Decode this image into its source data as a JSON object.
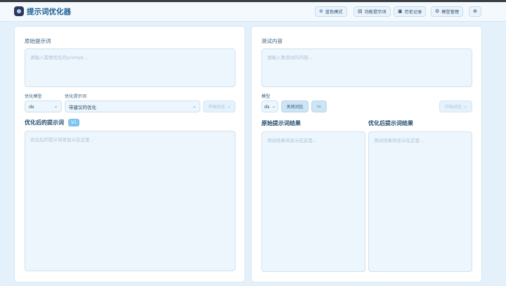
{
  "header": {
    "title": "提示词优化器",
    "buttons": [
      {
        "icon": "plus-circle-icon",
        "glyph": "⊕",
        "label": "蓝色模式"
      },
      {
        "icon": "document-icon",
        "glyph": "▤",
        "label": "功能提示词"
      },
      {
        "icon": "history-icon",
        "glyph": "▣",
        "label": "历史记录"
      },
      {
        "icon": "gear-icon",
        "glyph": "⚙",
        "label": "模型管理"
      }
    ],
    "globe_glyph": "⊕"
  },
  "left": {
    "original_label": "原始提示词",
    "original_placeholder": "请输入需要优化的prompt...",
    "model_label": "优化模型",
    "model_value": "ds",
    "prompt_label": "优化提示词",
    "prompt_value": "带建议的优化",
    "start_button": "开始优化 →",
    "optimized_title": "优化后的提示词",
    "version_badge": "V1",
    "optimized_placeholder": "优化后的提示词将显示在这里..."
  },
  "right": {
    "test_label": "测试内容",
    "test_placeholder": "请输入要测试的内容...",
    "model_label": "模型",
    "model_value": "ds",
    "compare_button": "关闭对比",
    "compare_icon_glyph": "▭",
    "start_button": "开始对比 →",
    "original_result_title": "原始提示词结果",
    "original_result_placeholder": "测试结果将显示在这里...",
    "optimized_result_title": "优化后提示词结果",
    "optimized_result_placeholder": "测试结果将显示在这里..."
  },
  "colors": {
    "accent": "#1b5f93",
    "background": "#e4f0fa",
    "panel": "#ffffff"
  }
}
